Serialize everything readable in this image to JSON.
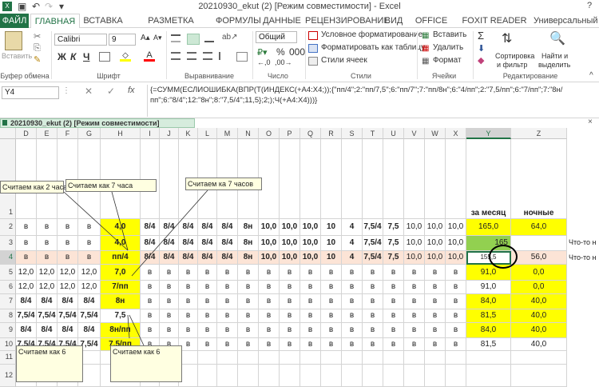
{
  "window": {
    "title": "20210930_ekut (2)  [Режим совместимости] - Excel",
    "help": "?"
  },
  "tabs": [
    "ФАЙЛ",
    "ГЛАВНАЯ",
    "ВСТАВКА",
    "РАЗМЕТКА СТРАНИЦЫ",
    "ФОРМУЛЫ",
    "ДАННЫЕ",
    "РЕЦЕНЗИРОВАНИЕ",
    "ВИД",
    "OFFICE TAB",
    "FOXIT READER PDF",
    "Универсальный к"
  ],
  "ribbon": {
    "paste": "Вставить",
    "font_name": "Calibri",
    "font_size": "9",
    "number_format": "Общий",
    "bold": "Ж",
    "italic": "К",
    "underline": "Ч",
    "cond_format": "Условное форматирование",
    "format_table": "Форматировать как таблицу",
    "cell_styles": "Стили ячеек",
    "insert": "Вставить",
    "delete": "Удалить",
    "format": "Формат",
    "sort_1": "Сортировка",
    "sort_2": "и фильтр",
    "find_1": "Найти и",
    "find_2": "выделить",
    "groups": [
      "Буфер обмена",
      "Шрифт",
      "Выравнивание",
      "Число",
      "Стили",
      "Ячейки",
      "Редактирование"
    ]
  },
  "formula_bar": {
    "name_box": "Y4",
    "fx": "fx",
    "line1": "{=СУММ(ЕСЛИОШИБКА(ВПР(Т(ИНДЕКС(+A4:X4;));{\"пп/4\";2:\"пп/7,5\";6:\"пп/7\";7:\"пп/8н\";6:\"4/пп\";2:\"7,5/пп\";6:\"7/пп\";7:\"8н/",
    "line2": "пп\";6:\"8/4\";12:\"8н\";8:\"7,5/4\";11,5};2;);Ч(+A4:X4)))}"
  },
  "workbook_tab": {
    "label": "20210930_ekut (2)  [Режим совместимости]",
    "close": "×"
  },
  "columns": [
    "D",
    "E",
    "F",
    "G",
    "H",
    "I",
    "J",
    "K",
    "L",
    "M",
    "N",
    "O",
    "P",
    "Q",
    "R",
    "S",
    "T",
    "U",
    "V",
    "W",
    "X",
    "Y",
    "Z"
  ],
  "rows": {
    "r1": {
      "Y": "за месяц",
      "Z": "ночные"
    },
    "r2": [
      "в",
      "в",
      "в",
      "в",
      "4,0",
      "8/4",
      "8/4",
      "8/4",
      "8/4",
      "8/4",
      "8н",
      "10,0",
      "10,0",
      "10,0",
      "10",
      "4",
      "7,5/4",
      "7,5",
      "10,0",
      "10,0",
      "10,0",
      "165,0",
      "64,0"
    ],
    "r3": [
      "в",
      "в",
      "в",
      "в",
      "4,0",
      "8/4",
      "8/4",
      "8/4",
      "8/4",
      "8/4",
      "8н",
      "10,0",
      "10,0",
      "10,0",
      "10",
      "4",
      "7,5/4",
      "7,5",
      "10,0",
      "10,0",
      "10,0",
      "165",
      ""
    ],
    "r3_extra": "Что-то н",
    "r4": [
      "в",
      "в",
      "в",
      "в",
      "пп/4",
      "8/4",
      "8/4",
      "8/4",
      "8/4",
      "8/4",
      "8н",
      "10,0",
      "10,0",
      "10,0",
      "10",
      "4",
      "7,5/4",
      "7,5",
      "10,0",
      "10,0",
      "10,0",
      "155,5",
      "56,0"
    ],
    "r4_extra": "Что-то н",
    "r5": [
      "12,0",
      "12,0",
      "12,0",
      "12,0",
      "7,0",
      "в",
      "в",
      "в",
      "в",
      "в",
      "в",
      "в",
      "в",
      "в",
      "в",
      "в",
      "в",
      "в",
      "в",
      "в",
      "в",
      "91,0",
      "0,0"
    ],
    "r6": [
      "12,0",
      "12,0",
      "12,0",
      "12,0",
      "7/пп",
      "в",
      "в",
      "в",
      "в",
      "в",
      "в",
      "в",
      "в",
      "в",
      "в",
      "в",
      "в",
      "в",
      "в",
      "в",
      "в",
      "91,0",
      "0,0"
    ],
    "r7": [
      "8/4",
      "8/4",
      "8/4",
      "8/4",
      "8н",
      "в",
      "в",
      "в",
      "в",
      "в",
      "в",
      "в",
      "в",
      "в",
      "в",
      "в",
      "в",
      "в",
      "в",
      "в",
      "в",
      "84,0",
      "40,0"
    ],
    "r8": [
      "7,5/4",
      "7,5/4",
      "7,5/4",
      "7,5/4",
      "7,5",
      "в",
      "в",
      "в",
      "в",
      "в",
      "в",
      "в",
      "в",
      "в",
      "в",
      "в",
      "в",
      "в",
      "в",
      "в",
      "в",
      "81,5",
      "40,0"
    ],
    "r9": [
      "8/4",
      "8/4",
      "8/4",
      "8/4",
      "8н/пп",
      "в",
      "в",
      "в",
      "в",
      "в",
      "в",
      "в",
      "в",
      "в",
      "в",
      "в",
      "в",
      "в",
      "в",
      "в",
      "в",
      "84,0",
      "40,0"
    ],
    "r10": [
      "7,5/4",
      "7,5/4",
      "7,5/4",
      "7,5/4",
      "7,5/пп",
      "в",
      "в",
      "в",
      "в",
      "в",
      "в",
      "в",
      "в",
      "в",
      "в",
      "в",
      "в",
      "в",
      "в",
      "в",
      "в",
      "81,5",
      "40,0"
    ]
  },
  "row_numbers": [
    "1",
    "2",
    "3",
    "4",
    "5",
    "6",
    "7",
    "8",
    "9",
    "10",
    "11",
    "12"
  ],
  "notes": {
    "n1": "Считаем как 2 часа",
    "n2": "Считаем как 7 часа",
    "n3": "Считаем ка 7 часов",
    "n4": "Считаем как 6",
    "n5": "Считаем как 6"
  },
  "colors": {
    "accent": "#217346",
    "yellow": "#ffff00",
    "green": "#92d050",
    "peach": "#fce4d6"
  }
}
